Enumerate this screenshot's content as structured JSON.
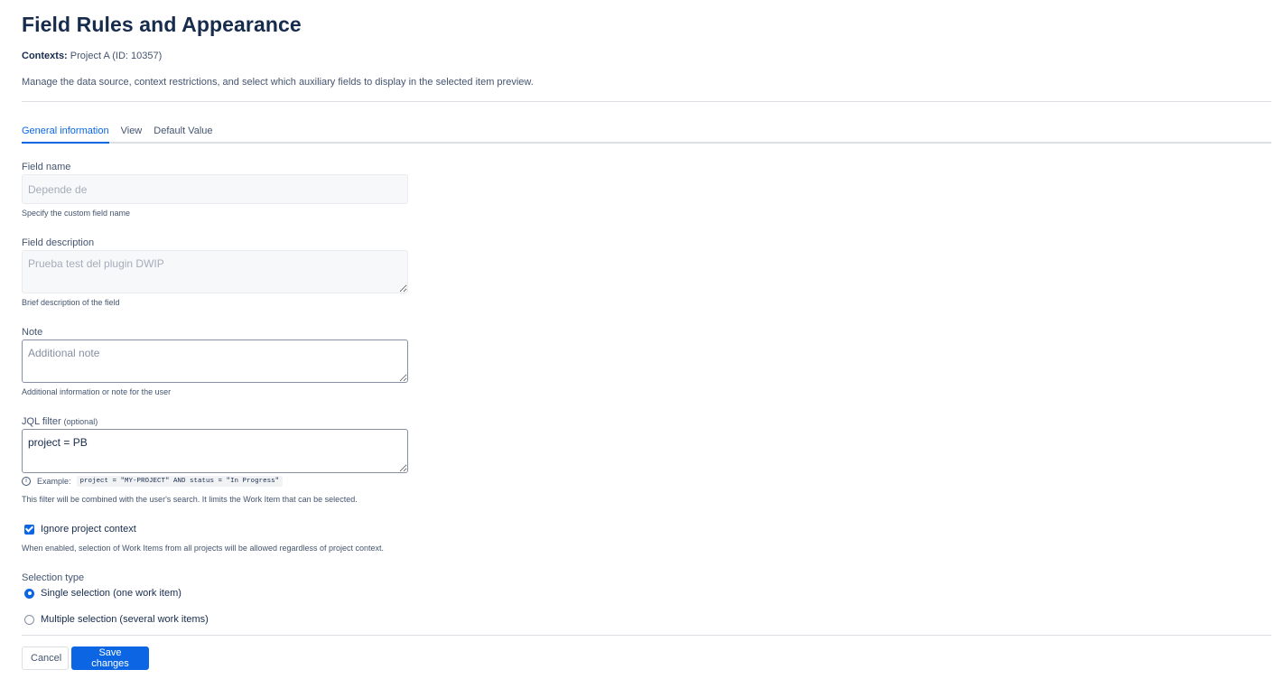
{
  "header": {
    "title": "Field Rules and Appearance",
    "contexts_label": "Contexts:",
    "contexts_value": "Project A (ID: 10357)",
    "description": "Manage the data source, context restrictions, and select which auxiliary fields to display in the selected item preview."
  },
  "tabs": [
    {
      "label": "General information",
      "active": true
    },
    {
      "label": "View",
      "active": false
    },
    {
      "label": "Default Value",
      "active": false
    }
  ],
  "form": {
    "field_name": {
      "label": "Field name",
      "placeholder": "Depende de",
      "help": "Specify the custom field name"
    },
    "field_description": {
      "label": "Field description",
      "placeholder": "Prueba test del plugin DWIP",
      "help": "Brief description of the field"
    },
    "note": {
      "label": "Note",
      "placeholder": "Additional note",
      "help": "Additional information or note for the user"
    },
    "jql_filter": {
      "label": "JQL filter",
      "optional": "(optional)",
      "value": "project = PB",
      "example_label": "Example:",
      "example_code": "project = \"MY-PROJECT\" AND status = \"In Progress\"",
      "help": "This filter will be combined with the user's search. It limits the Work Item that can be selected."
    },
    "ignore_context": {
      "label": "Ignore project context",
      "checked": true,
      "help": "When enabled, selection of Work Items from all projects will be allowed regardless of project context."
    },
    "selection_type": {
      "label": "Selection type",
      "options": [
        {
          "label": "Single selection (one work item)",
          "selected": true
        },
        {
          "label": "Multiple selection (several work items)",
          "selected": false
        }
      ]
    }
  },
  "footer": {
    "cancel_label": "Cancel",
    "save_label": "Save changes"
  },
  "colors": {
    "accent": "#0c66e4",
    "text": "#172b4d",
    "subtle_text": "#44546f",
    "border": "#dcdfe4"
  }
}
